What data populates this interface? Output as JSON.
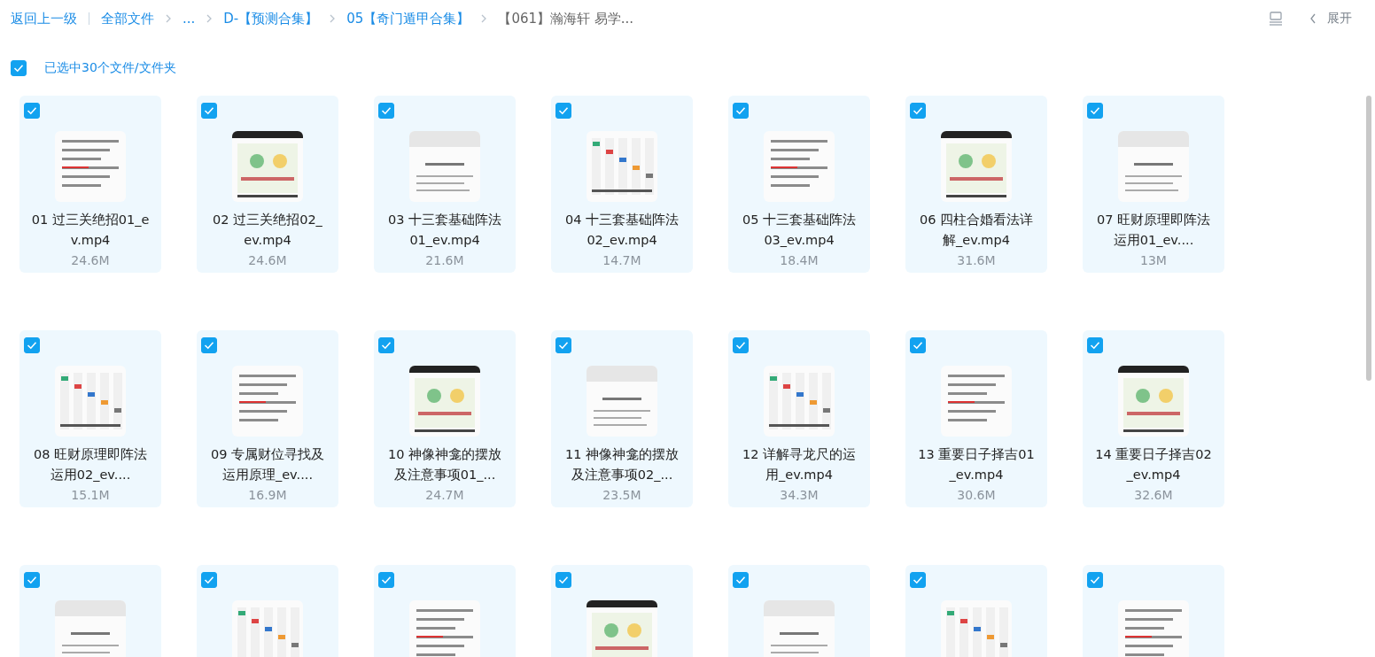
{
  "breadcrumb": {
    "back": "返回上一级",
    "items": [
      {
        "label": "全部文件",
        "current": false
      },
      {
        "label": "...",
        "current": false
      },
      {
        "label": "D-【预测合集】",
        "current": false
      },
      {
        "label": "05【奇门遁甲合集】",
        "current": false
      },
      {
        "label": "【061】瀚海轩 易学...",
        "current": true
      }
    ]
  },
  "toolbar": {
    "expand": "展开"
  },
  "selection": {
    "checked": true,
    "label": "已选中30个文件/文件夹"
  },
  "files": [
    {
      "selected": true,
      "name_lines": [
        "01 过三关绝招01_e",
        "v.mp4"
      ],
      "size": "24.6M"
    },
    {
      "selected": true,
      "name_lines": [
        "02 过三关绝招02_",
        "ev.mp4"
      ],
      "size": "24.6M"
    },
    {
      "selected": true,
      "name_lines": [
        "03 十三套基础阵法",
        "01_ev.mp4"
      ],
      "size": "21.6M"
    },
    {
      "selected": true,
      "name_lines": [
        "04 十三套基础阵法",
        "02_ev.mp4"
      ],
      "size": "14.7M"
    },
    {
      "selected": true,
      "name_lines": [
        "05 十三套基础阵法",
        "03_ev.mp4"
      ],
      "size": "18.4M"
    },
    {
      "selected": true,
      "name_lines": [
        "06 四柱合婚看法详",
        "解_ev.mp4"
      ],
      "size": "31.6M"
    },
    {
      "selected": true,
      "name_lines": [
        "07 旺财原理即阵法",
        "运用01_ev...."
      ],
      "size": "13M"
    },
    {
      "selected": true,
      "name_lines": [
        "08 旺财原理即阵法",
        "运用02_ev...."
      ],
      "size": "15.1M"
    },
    {
      "selected": true,
      "name_lines": [
        "09 专属财位寻找及",
        "运用原理_ev...."
      ],
      "size": "16.9M"
    },
    {
      "selected": true,
      "name_lines": [
        "10 神像神龛的摆放",
        "及注意事项01_..."
      ],
      "size": "24.7M"
    },
    {
      "selected": true,
      "name_lines": [
        "11 神像神龛的摆放",
        "及注意事项02_..."
      ],
      "size": "23.5M"
    },
    {
      "selected": true,
      "name_lines": [
        "12 详解寻龙尺的运",
        "用_ev.mp4"
      ],
      "size": "34.3M"
    },
    {
      "selected": true,
      "name_lines": [
        "13 重要日子择吉01",
        "_ev.mp4"
      ],
      "size": "30.6M"
    },
    {
      "selected": true,
      "name_lines": [
        "14 重要日子择吉02",
        "_ev.mp4"
      ],
      "size": "32.6M"
    },
    {
      "selected": true
    },
    {
      "selected": true
    },
    {
      "selected": true
    },
    {
      "selected": true
    },
    {
      "selected": true
    },
    {
      "selected": true
    },
    {
      "selected": true
    }
  ]
}
